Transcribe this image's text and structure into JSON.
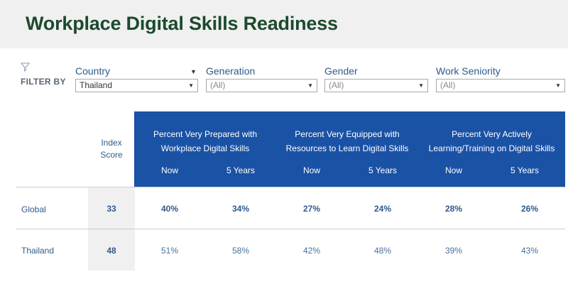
{
  "title": "Workplace Digital Skills Readiness",
  "filters": {
    "filter_by_label": "FILTER BY",
    "country": {
      "label": "Country",
      "value": "Thailand"
    },
    "generation": {
      "label": "Generation",
      "value": "(All)"
    },
    "gender": {
      "label": "Gender",
      "value": "(All)"
    },
    "seniority": {
      "label": "Work Seniority",
      "value": "(All)"
    }
  },
  "table": {
    "index_header": [
      "Index",
      "Score"
    ],
    "groups": [
      {
        "line1": "Percent Very Prepared with",
        "line2": "Workplace Digital Skills"
      },
      {
        "line1": "Percent Very Equipped with",
        "line2": "Resources to Learn Digital Skills"
      },
      {
        "line1": "Percent Very Actively",
        "line2": "Learning/Training on Digital Skills"
      }
    ],
    "sub_headers": [
      "Now",
      "5 Years",
      "Now",
      "5 Years",
      "Now",
      "5 Years"
    ],
    "rows": [
      {
        "label": "Global",
        "index": "33",
        "values": [
          "40%",
          "34%",
          "27%",
          "24%",
          "28%",
          "26%"
        ]
      },
      {
        "label": "Thailand",
        "index": "48",
        "values": [
          "51%",
          "58%",
          "42%",
          "48%",
          "39%",
          "43%"
        ]
      }
    ]
  },
  "colors": {
    "header_blue": "#1a52a6",
    "title_green": "#1c4a2e",
    "text_blue": "#2f5a8a",
    "header_bg": "#f0f0f0"
  },
  "icons": {
    "filter": "filter-icon",
    "dropdown": "chevron-down-icon"
  }
}
